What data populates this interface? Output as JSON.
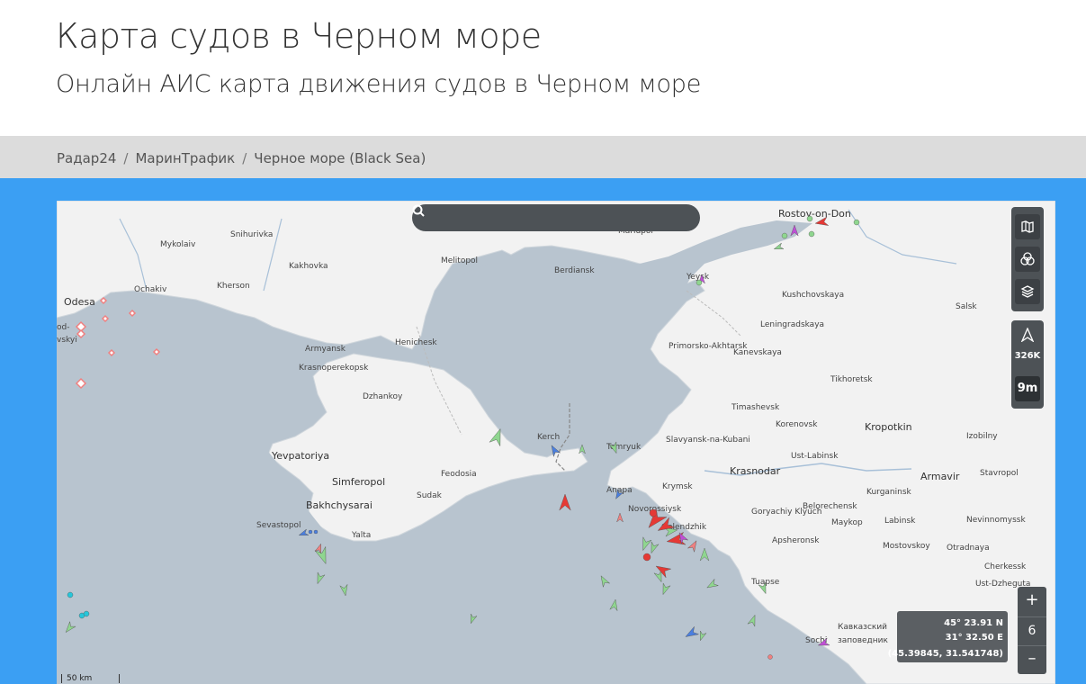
{
  "page": {
    "title": "Карта судов в Черном море",
    "subtitle": "Онлайн АИС карта движения судов в Черном море"
  },
  "breadcrumbs": [
    {
      "label": "Радар24"
    },
    {
      "label": "МаринТрафик"
    },
    {
      "label": "Черное море (Black Sea)"
    }
  ],
  "map": {
    "places": [
      {
        "name": "Mykolaiv"
      },
      {
        "name": "Snihurivka"
      },
      {
        "name": "Kakhovka"
      },
      {
        "name": "Melitopol"
      },
      {
        "name": "Berdiansk"
      },
      {
        "name": "Mariupol"
      },
      {
        "name": "Rostov-on-Don"
      },
      {
        "name": "Odesa"
      },
      {
        "name": "Ochakiv"
      },
      {
        "name": "Kherson"
      },
      {
        "name": "Yeysk"
      },
      {
        "name": "Kushchovskaya"
      },
      {
        "name": "Salsk"
      },
      {
        "name": "Armyansk"
      },
      {
        "name": "Henichesk"
      },
      {
        "name": "Leningradskaya"
      },
      {
        "name": "Krasnoperekopsk"
      },
      {
        "name": "Primorsko-Akhtarsk"
      },
      {
        "name": "Kanevskaya"
      },
      {
        "name": "Dzhankoy"
      },
      {
        "name": "Tikhoretsk"
      },
      {
        "name": "Timashevsk"
      },
      {
        "name": "Korenovsk"
      },
      {
        "name": "Kropotkin"
      },
      {
        "name": "Kerch"
      },
      {
        "name": "Temryuk"
      },
      {
        "name": "Slavyansk-na-Kubani"
      },
      {
        "name": "Izobilny"
      },
      {
        "name": "Yevpatoriya"
      },
      {
        "name": "Feodosia"
      },
      {
        "name": "Ust-Labinsk"
      },
      {
        "name": "Simferopol"
      },
      {
        "name": "Sudak"
      },
      {
        "name": "Anapa"
      },
      {
        "name": "Krymsk"
      },
      {
        "name": "Krasnodar"
      },
      {
        "name": "Armavir"
      },
      {
        "name": "Stavropol"
      },
      {
        "name": "Bakhchysarai"
      },
      {
        "name": "Novorossiysk"
      },
      {
        "name": "Belorechensk"
      },
      {
        "name": "Kurganinsk"
      },
      {
        "name": "Sevastopol"
      },
      {
        "name": "Gelendzhik"
      },
      {
        "name": "Goryachiy Klyuch"
      },
      {
        "name": "Maykop"
      },
      {
        "name": "Labinsk"
      },
      {
        "name": "Nevinnomyssk"
      },
      {
        "name": "Yalta"
      },
      {
        "name": "Apsheronsk"
      },
      {
        "name": "Mostovskoy"
      },
      {
        "name": "Otradnaya"
      },
      {
        "name": "Cherkessk"
      },
      {
        "name": "Tuapse"
      },
      {
        "name": "Ust-Dzheguta"
      },
      {
        "name": "Sochi"
      },
      {
        "name": "Кавказский"
      },
      {
        "name": "заповедник"
      },
      {
        "name": "od-"
      },
      {
        "name": "vskyi"
      }
    ],
    "vessel_count": "326K",
    "time_window": "9m",
    "zoom_level": "6",
    "zoom_in": "+",
    "zoom_out": "–",
    "coords": {
      "lat": "45° 23.91 N",
      "lon": "31° 32.50 E",
      "decimal": "(45.39845, 31.541748)"
    },
    "scale_label": "50 km",
    "colors": {
      "land": "#f2f2f2",
      "sea": "#b8c4cf",
      "frame": "#3b9ff3",
      "cargo": "#8fd68f",
      "tanker": "#e53935",
      "passenger": "#4a7fe0",
      "fishing": "#f08080",
      "tug": "#26c6da",
      "pleasure": "#c04ed6"
    }
  }
}
